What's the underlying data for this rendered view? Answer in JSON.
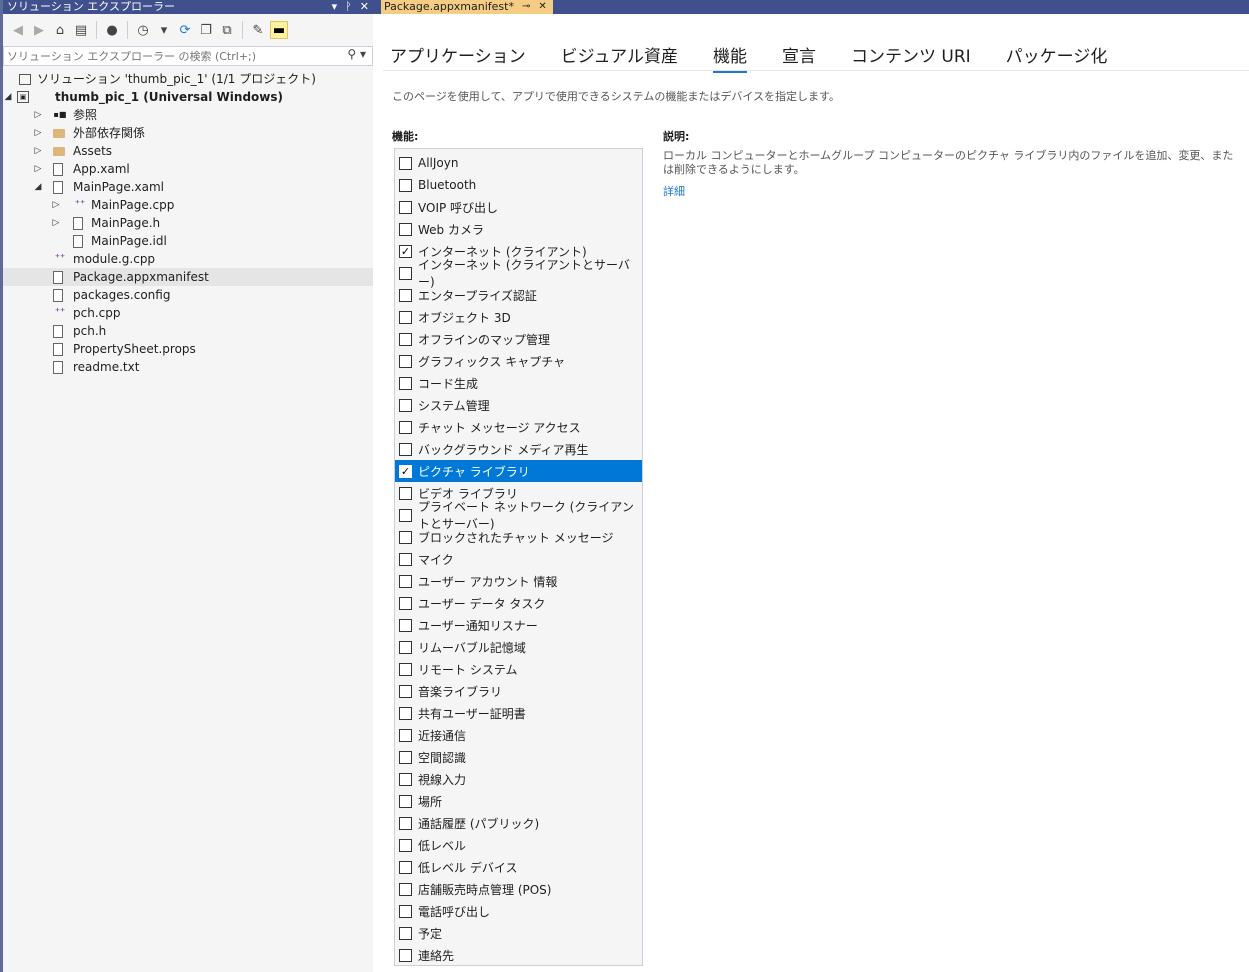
{
  "solution_explorer": {
    "title": "ソリューション エクスプローラー",
    "title_buttons": [
      "▾",
      "ᚹ",
      "✕"
    ],
    "search_placeholder": "ソリューション エクスプローラー の検索 (Ctrl+;)",
    "tree": [
      {
        "label": "ソリューション 'thumb_pic_1' (1/1 プロジェクト)",
        "level": 0,
        "arrow": "",
        "icon": "solution-icon",
        "bold": false,
        "selected": false
      },
      {
        "label": "thumb_pic_1 (Universal Windows)",
        "level": 0,
        "arrow": "◢",
        "icon": "project-icon",
        "bold": true,
        "selected": false
      },
      {
        "label": "参照",
        "level": 1,
        "arrow": "▷",
        "icon": "references-icon",
        "bold": false,
        "selected": false
      },
      {
        "label": "外部依存関係",
        "level": 1,
        "arrow": "▷",
        "icon": "external-deps-icon",
        "bold": false,
        "selected": false
      },
      {
        "label": "Assets",
        "level": 1,
        "arrow": "▷",
        "icon": "folder-icon",
        "bold": false,
        "selected": false
      },
      {
        "label": "App.xaml",
        "level": 1,
        "arrow": "▷",
        "icon": "xaml-file-icon",
        "bold": false,
        "selected": false
      },
      {
        "label": "MainPage.xaml",
        "level": 1,
        "arrow": "◢",
        "icon": "xaml-file-icon",
        "bold": false,
        "selected": false
      },
      {
        "label": "MainPage.cpp",
        "level": 2,
        "arrow": "▷",
        "icon": "cpp-file-icon",
        "bold": false,
        "selected": false
      },
      {
        "label": "MainPage.h",
        "level": 2,
        "arrow": "▷",
        "icon": "header-file-icon",
        "bold": false,
        "selected": false
      },
      {
        "label": "MainPage.idl",
        "level": 2,
        "arrow": "",
        "icon": "file-icon",
        "bold": false,
        "selected": false
      },
      {
        "label": "module.g.cpp",
        "level": 1,
        "arrow": "",
        "icon": "cpp-file-icon",
        "bold": false,
        "selected": false
      },
      {
        "label": "Package.appxmanifest",
        "level": 1,
        "arrow": "",
        "icon": "manifest-file-icon",
        "bold": false,
        "selected": true
      },
      {
        "label": "packages.config",
        "level": 1,
        "arrow": "",
        "icon": "config-file-icon",
        "bold": false,
        "selected": false
      },
      {
        "label": "pch.cpp",
        "level": 1,
        "arrow": "",
        "icon": "cpp-file-icon",
        "bold": false,
        "selected": false
      },
      {
        "label": "pch.h",
        "level": 1,
        "arrow": "",
        "icon": "header-file-icon",
        "bold": false,
        "selected": false
      },
      {
        "label": "PropertySheet.props",
        "level": 1,
        "arrow": "",
        "icon": "props-file-icon",
        "bold": false,
        "selected": false
      },
      {
        "label": "readme.txt",
        "level": 1,
        "arrow": "",
        "icon": "text-file-icon",
        "bold": false,
        "selected": false
      }
    ]
  },
  "document": {
    "tab_label": "Package.appxmanifest*",
    "tab_pin": "⊸",
    "tab_close": "✕",
    "nav_tabs": [
      {
        "label": "アプリケーション",
        "active": false
      },
      {
        "label": "ビジュアル資産",
        "active": false
      },
      {
        "label": "機能",
        "active": true
      },
      {
        "label": "宣言",
        "active": false
      },
      {
        "label": "コンテンツ URI",
        "active": false
      },
      {
        "label": "パッケージ化",
        "active": false
      }
    ],
    "description": "このページを使用して、アプリで使用できるシステムの機能またはデバイスを指定します。",
    "capabilities_label": "機能:",
    "capabilities": [
      {
        "label": "AllJoyn",
        "checked": false,
        "selected": false
      },
      {
        "label": "Bluetooth",
        "checked": false,
        "selected": false
      },
      {
        "label": "VOIP 呼び出し",
        "checked": false,
        "selected": false
      },
      {
        "label": "Web カメラ",
        "checked": false,
        "selected": false
      },
      {
        "label": "インターネット (クライアント)",
        "checked": true,
        "selected": false
      },
      {
        "label": "インターネット (クライアントとサーバー)",
        "checked": false,
        "selected": false
      },
      {
        "label": "エンタープライズ認証",
        "checked": false,
        "selected": false
      },
      {
        "label": "オブジェクト 3D",
        "checked": false,
        "selected": false
      },
      {
        "label": "オフラインのマップ管理",
        "checked": false,
        "selected": false
      },
      {
        "label": "グラフィックス キャプチャ",
        "checked": false,
        "selected": false
      },
      {
        "label": "コード生成",
        "checked": false,
        "selected": false
      },
      {
        "label": "システム管理",
        "checked": false,
        "selected": false
      },
      {
        "label": "チャット メッセージ アクセス",
        "checked": false,
        "selected": false
      },
      {
        "label": "バックグラウンド メディア再生",
        "checked": false,
        "selected": false
      },
      {
        "label": "ピクチャ ライブラリ",
        "checked": true,
        "selected": true
      },
      {
        "label": "ビデオ ライブラリ",
        "checked": false,
        "selected": false
      },
      {
        "label": "プライベート ネットワーク (クライアントとサーバー)",
        "checked": false,
        "selected": false
      },
      {
        "label": "ブロックされたチャット メッセージ",
        "checked": false,
        "selected": false
      },
      {
        "label": "マイク",
        "checked": false,
        "selected": false
      },
      {
        "label": "ユーザー アカウント 情報",
        "checked": false,
        "selected": false
      },
      {
        "label": "ユーザー データ タスク",
        "checked": false,
        "selected": false
      },
      {
        "label": "ユーザー通知リスナー",
        "checked": false,
        "selected": false
      },
      {
        "label": "リムーバブル記憶域",
        "checked": false,
        "selected": false
      },
      {
        "label": "リモート システム",
        "checked": false,
        "selected": false
      },
      {
        "label": "音楽ライブラリ",
        "checked": false,
        "selected": false
      },
      {
        "label": "共有ユーザー証明書",
        "checked": false,
        "selected": false
      },
      {
        "label": "近接通信",
        "checked": false,
        "selected": false
      },
      {
        "label": "空間認識",
        "checked": false,
        "selected": false
      },
      {
        "label": "視線入力",
        "checked": false,
        "selected": false
      },
      {
        "label": "場所",
        "checked": false,
        "selected": false
      },
      {
        "label": "通話履歴 (パブリック)",
        "checked": false,
        "selected": false
      },
      {
        "label": "低レベル",
        "checked": false,
        "selected": false
      },
      {
        "label": "低レベル デバイス",
        "checked": false,
        "selected": false
      },
      {
        "label": "店舗販売時点管理 (POS)",
        "checked": false,
        "selected": false
      },
      {
        "label": "電話呼び出し",
        "checked": false,
        "selected": false
      },
      {
        "label": "予定",
        "checked": false,
        "selected": false
      },
      {
        "label": "連絡先",
        "checked": false,
        "selected": false
      }
    ],
    "explanation_label": "説明:",
    "explanation_text": "ローカル コンピューターとホームグループ コンピューターのピクチャ ライブラリ内のファイルを追加、変更、または削除できるようにします。",
    "details_link": "詳細"
  },
  "colors": {
    "title_bar": "#40508d",
    "tab_active": "#f5cc84",
    "selection_blue": "#0078d7",
    "accent": "#1e78d2"
  }
}
